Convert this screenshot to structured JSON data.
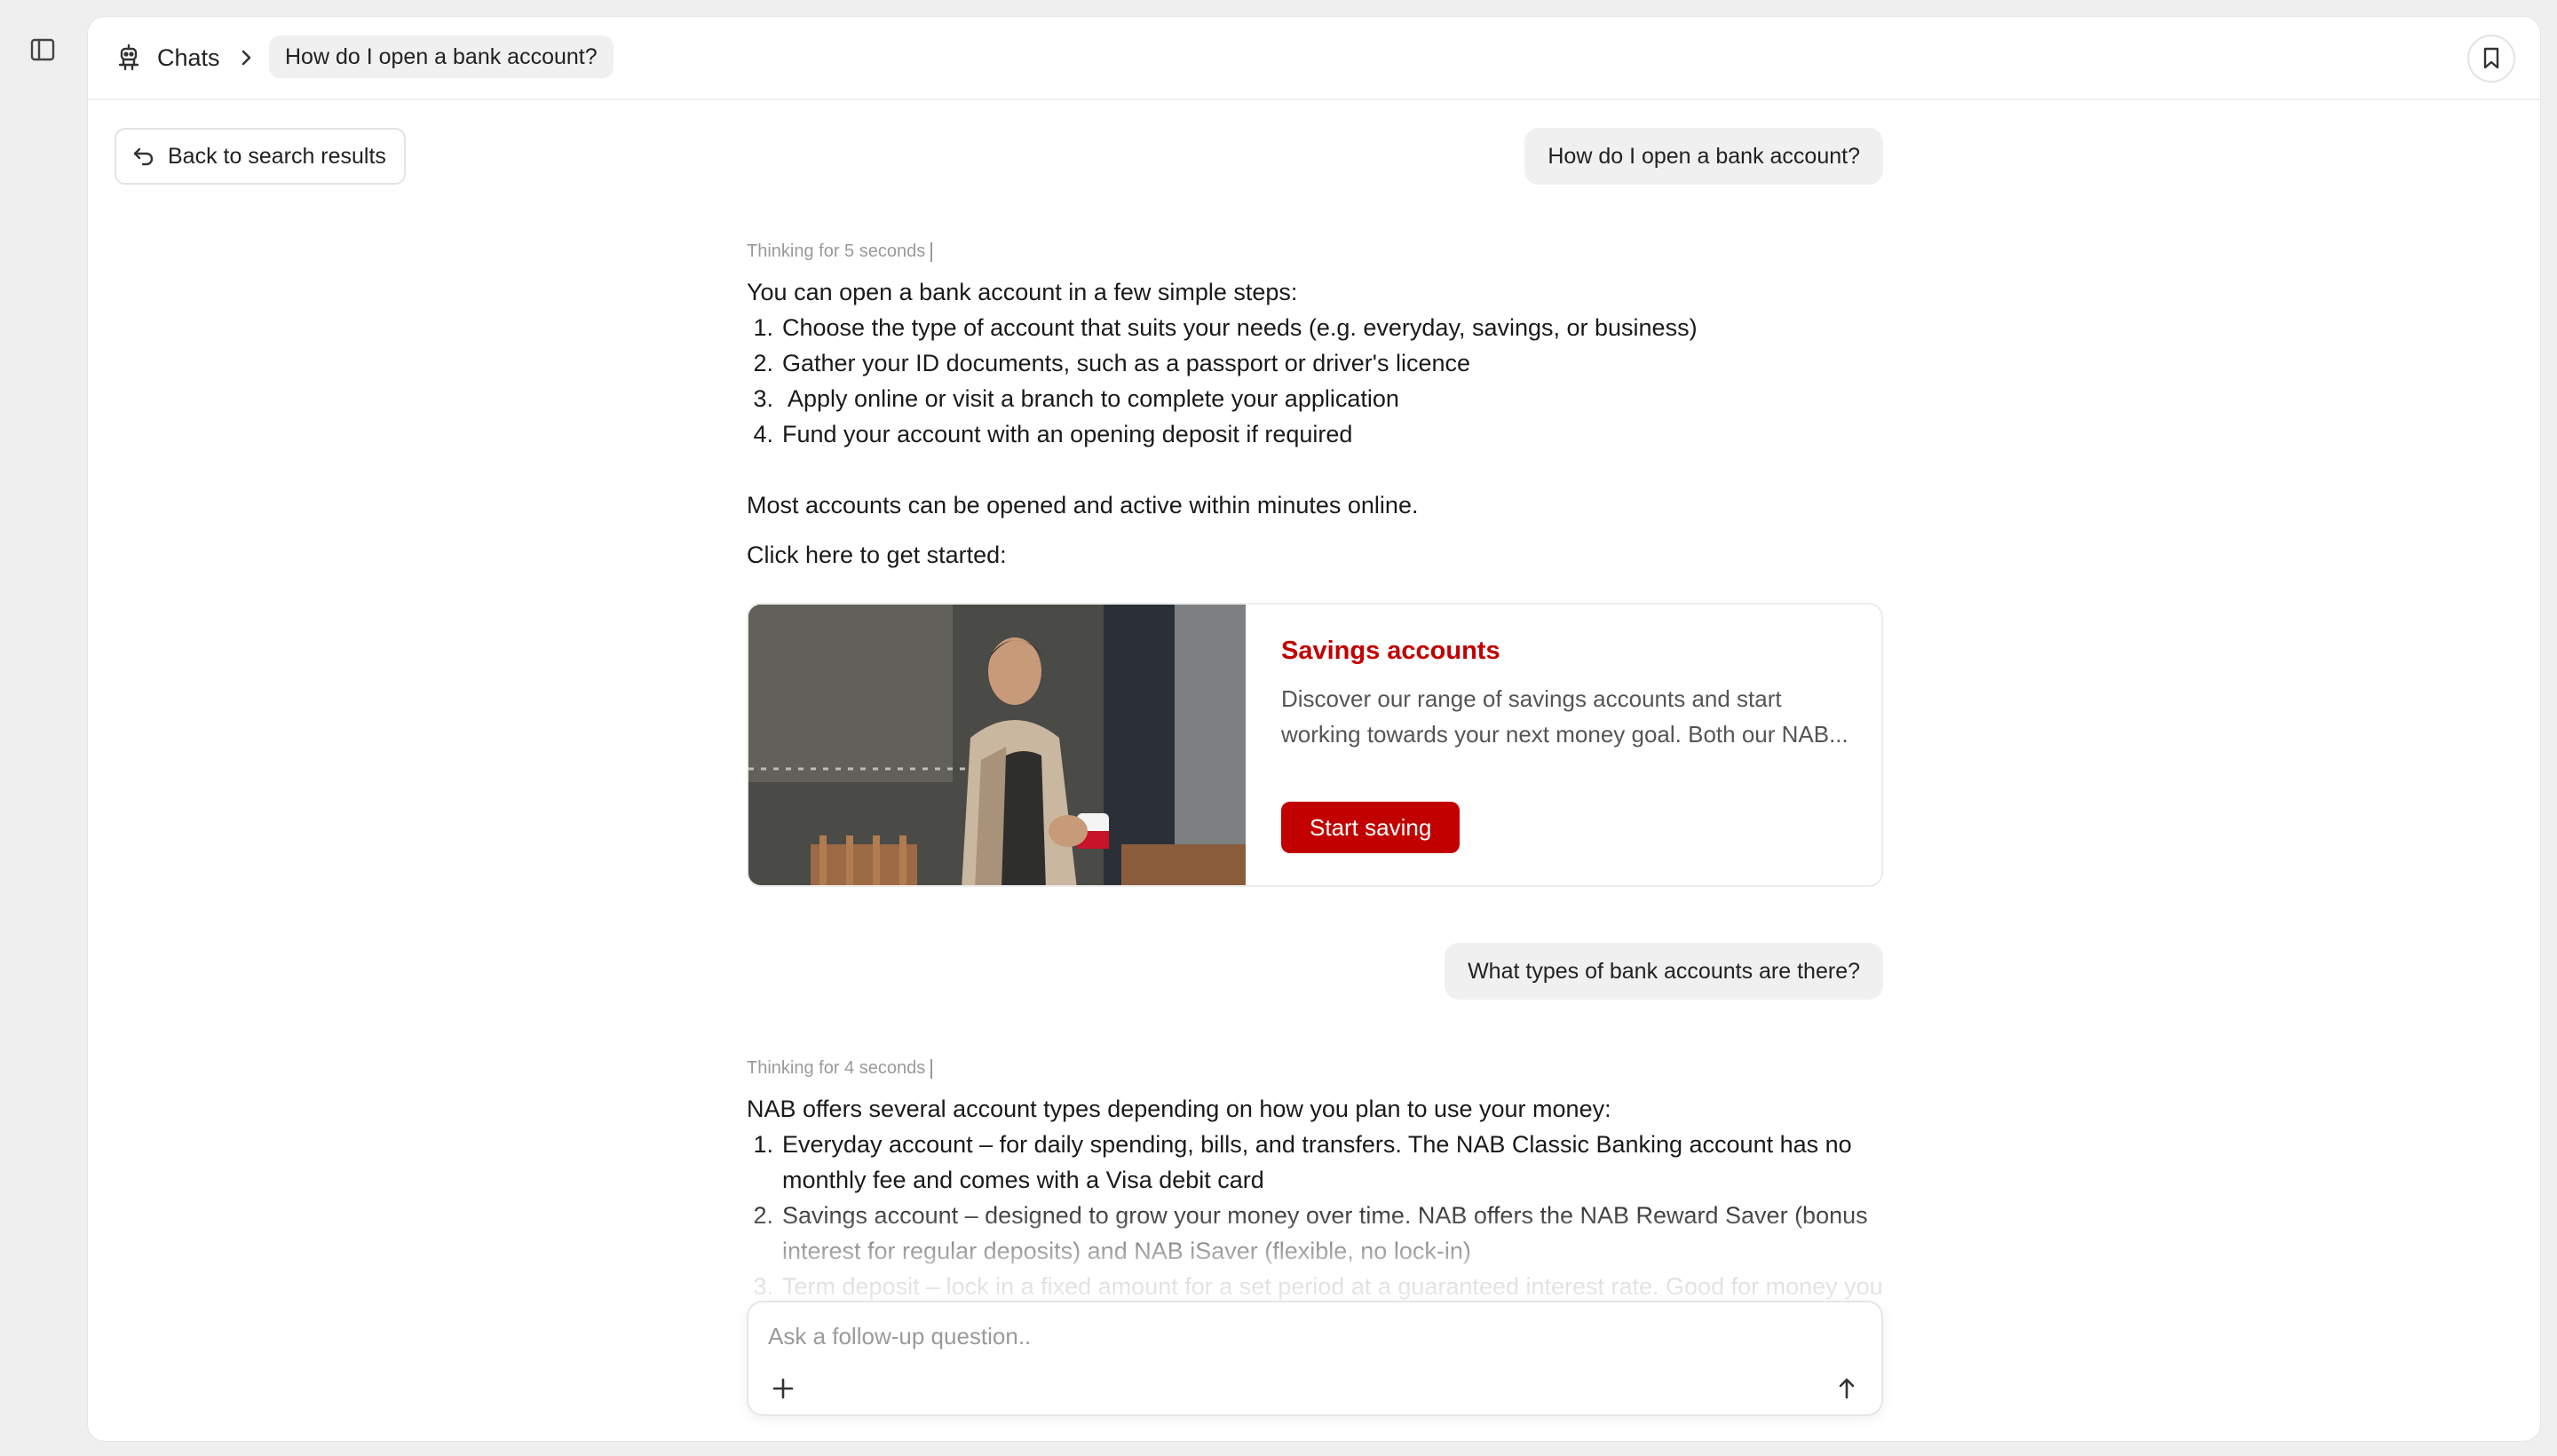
{
  "header": {
    "chats_label": "Chats",
    "current_chat": "How do I open a bank account?"
  },
  "back_button": {
    "label": "Back to search results"
  },
  "conversation": {
    "message1": {
      "user": "How do I open a bank account?",
      "thinking": "Thinking for 5 seconds",
      "intro": "You can open a bank account in a few simple steps:",
      "steps": [
        {
          "num": "1.",
          "text": "Choose the type of account that suits your needs (e.g. everyday, savings, or business)"
        },
        {
          "num": "2.",
          "text": "Gather your ID documents, such as a passport or driver's licence"
        },
        {
          "num": "3.",
          "text": " Apply online or visit a branch to complete your application"
        },
        {
          "num": "4.",
          "text": "Fund your account with an opening deposit if required"
        }
      ],
      "note": "Most accounts can be opened and active within minutes online.",
      "cta_intro": "Click here to get started:",
      "card": {
        "title": "Savings accounts",
        "description": "Discover our range of savings accounts and start working towards your next money goal. Both our NAB...",
        "button": "Start saving"
      }
    },
    "message2": {
      "user": "What types of bank accounts are there?",
      "thinking": "Thinking for 4 seconds",
      "intro": "NAB offers several account types depending on how you plan to use your money:",
      "items": [
        {
          "num": "1.",
          "text": "Everyday account – for daily spending, bills, and transfers. The NAB Classic Banking account has no monthly fee and comes with a Visa debit card"
        },
        {
          "num": "2.",
          "text": "Savings account – designed to grow your money over time. NAB offers the NAB Reward Saver (bonus interest for regular deposits) and NAB iSaver (flexible, no lock-in)"
        },
        {
          "num": "3.",
          "text": "Term deposit – lock in a fixed amount for a set period at a guaranteed interest rate. Good for money you won't need in the short term"
        }
      ]
    }
  },
  "composer": {
    "placeholder": "Ask a follow-up question.."
  },
  "colors": {
    "brand_red": "#c20000",
    "background": "#efefef",
    "panel": "#ffffff"
  },
  "icons": {
    "sidebar": "sidebar-toggle-icon",
    "bot": "bot-icon",
    "chevron": "chevron-right-icon",
    "bookmark": "bookmark-icon",
    "back": "return-arrow-icon",
    "add": "plus-icon",
    "send": "arrow-up-icon"
  }
}
